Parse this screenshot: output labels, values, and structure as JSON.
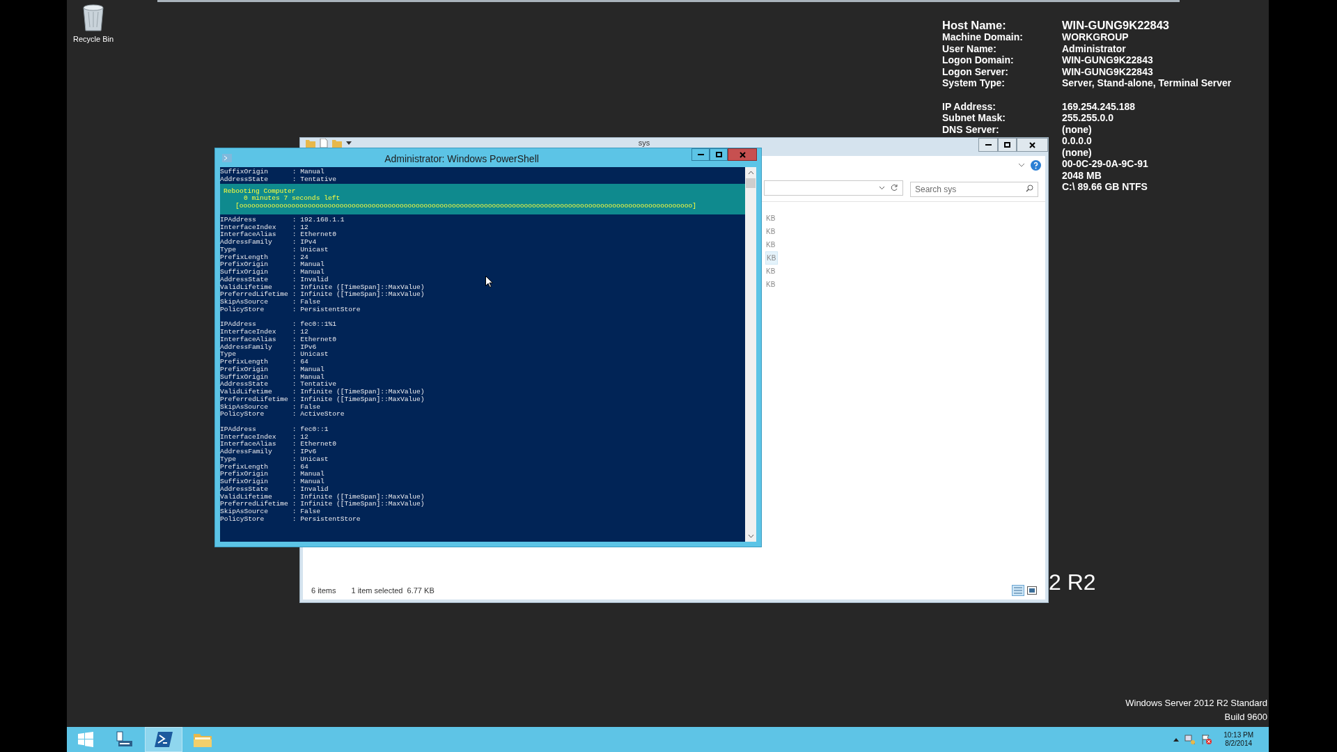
{
  "desktop": {
    "icons": [
      {
        "label": "Recycle Bin"
      }
    ],
    "wallpaper_text": "2 R2",
    "edition": "Windows Server 2012 R2 Standard",
    "build": "Build 9600"
  },
  "bginfo": {
    "sections": [
      [
        {
          "label": "Host Name:",
          "value": "WIN-GUNG9K22843"
        },
        {
          "label": "Machine Domain:",
          "value": "WORKGROUP"
        },
        {
          "label": "User Name:",
          "value": "Administrator"
        },
        {
          "label": "Logon Domain:",
          "value": "WIN-GUNG9K22843"
        },
        {
          "label": "Logon Server:",
          "value": "WIN-GUNG9K22843"
        },
        {
          "label": "System Type:",
          "value": "Server, Stand-alone, Terminal Server"
        }
      ],
      [
        {
          "label": "IP Address:",
          "value": "169.254.245.188"
        },
        {
          "label": "Subnet Mask:",
          "value": "255.255.0.0"
        },
        {
          "label": "DNS Server:",
          "value": "(none)"
        },
        {
          "value": "0.0.0.0"
        },
        {
          "value": "(none)"
        },
        {
          "value": "00-0C-29-0A-9C-91"
        },
        {
          "value": "2048 MB"
        },
        {
          "value": "C:\\ 89.66 GB NTFS"
        }
      ]
    ]
  },
  "explorer": {
    "title": "sys",
    "search": {
      "placeholder": "Search sys"
    },
    "rows": [
      {
        "size": "KB",
        "selected": false
      },
      {
        "size": "KB",
        "selected": false
      },
      {
        "size": "KB",
        "selected": false
      },
      {
        "size": "KB",
        "selected": true
      },
      {
        "size": "KB",
        "selected": false
      },
      {
        "size": "KB",
        "selected": false
      }
    ],
    "status": {
      "count": "6 items",
      "selection": "1 item selected",
      "size": "6.77 KB"
    }
  },
  "powershell": {
    "title": "Administrator: Windows PowerShell",
    "blocks_before": [
      [
        "SuffixOrigin      : Manual",
        "AddressState      : Tentative"
      ]
    ],
    "progress": {
      "activity": "Rebooting Computer",
      "status": "0 minutes 7 seconds left",
      "bar": "[ooooooooooooooooooooooooooooooooooooooooooooooooooooooooooooooooooooooooooooooooooooooooooooooooooooooooooooooooo]"
    },
    "blocks_after": [
      [
        "IPAddress         : 192.168.1.1",
        "InterfaceIndex    : 12",
        "InterfaceAlias    : Ethernet0",
        "AddressFamily     : IPv4",
        "Type              : Unicast",
        "PrefixLength      : 24",
        "PrefixOrigin      : Manual",
        "SuffixOrigin      : Manual",
        "AddressState      : Invalid",
        "ValidLifetime     : Infinite ([TimeSpan]::MaxValue)",
        "PreferredLifetime : Infinite ([TimeSpan]::MaxValue)",
        "SkipAsSource      : False",
        "PolicyStore       : PersistentStore"
      ],
      [
        "IPAddress         : fec0::1%1",
        "InterfaceIndex    : 12",
        "InterfaceAlias    : Ethernet0",
        "AddressFamily     : IPv6",
        "Type              : Unicast",
        "PrefixLength      : 64",
        "PrefixOrigin      : Manual",
        "SuffixOrigin      : Manual",
        "AddressState      : Tentative",
        "ValidLifetime     : Infinite ([TimeSpan]::MaxValue)",
        "PreferredLifetime : Infinite ([TimeSpan]::MaxValue)",
        "SkipAsSource      : False",
        "PolicyStore       : ActiveStore"
      ],
      [
        "IPAddress         : fec0::1",
        "InterfaceIndex    : 12",
        "InterfaceAlias    : Ethernet0",
        "AddressFamily     : IPv6",
        "Type              : Unicast",
        "PrefixLength      : 64",
        "PrefixOrigin      : Manual",
        "SuffixOrigin      : Manual",
        "AddressState      : Invalid",
        "ValidLifetime     : Infinite ([TimeSpan]::MaxValue)",
        "PreferredLifetime : Infinite ([TimeSpan]::MaxValue)",
        "SkipAsSource      : False",
        "PolicyStore       : PersistentStore"
      ]
    ]
  },
  "taskbar": {
    "apps": [
      {
        "kind": "start",
        "selected": false
      },
      {
        "kind": "server-manager",
        "selected": false
      },
      {
        "kind": "powershell",
        "selected": true
      },
      {
        "kind": "explorer",
        "selected": false
      }
    ],
    "clock": {
      "time": "10:13 PM",
      "date": "8/2/2014"
    }
  }
}
